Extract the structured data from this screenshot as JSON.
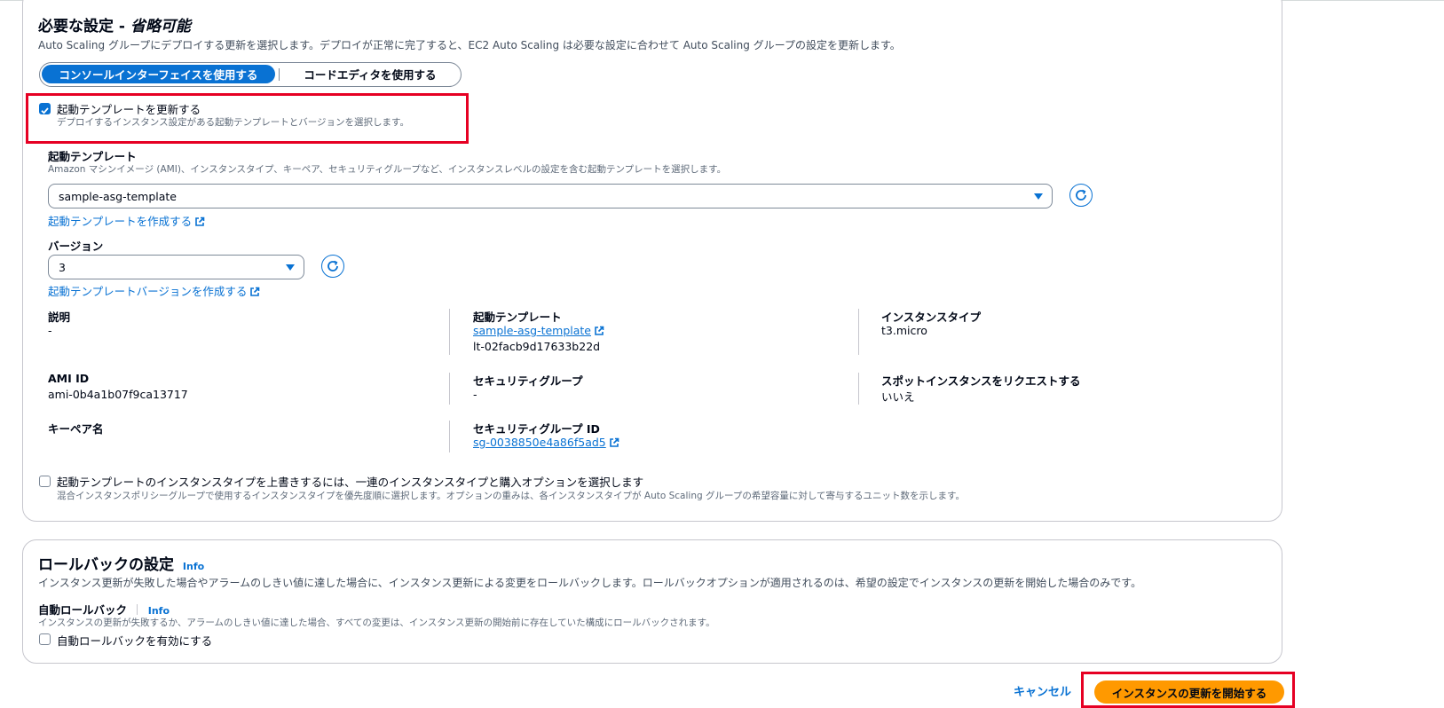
{
  "required_settings": {
    "title_main": "必要な設定 - ",
    "title_optional": "省略可能",
    "description": "Auto Scaling グループにデプロイする更新を選択します。デプロイが正常に完了すると、EC2 Auto Scaling は必要な設定に合わせて Auto Scaling グループの設定を更新します。",
    "segmented": {
      "console": "コンソールインターフェイスを使用する",
      "code_editor": "コードエディタを使用する"
    },
    "update_template": {
      "label": "起動テンプレートを更新する",
      "hint": "デプロイするインスタンス設定がある起動テンプレートとバージョンを選択します。",
      "checked": true
    },
    "launch_template": {
      "label": "起動テンプレート",
      "description": "Amazon マシンイメージ (AMI)、インスタンスタイプ、キーペア、セキュリティグループなど、インスタンスレベルの設定を含む起動テンプレートを選択します。",
      "selected": "sample-asg-template",
      "create_link": "起動テンプレートを作成する"
    },
    "version": {
      "label": "バージョン",
      "selected": "3",
      "create_link": "起動テンプレートバージョンを作成する"
    },
    "details": {
      "description_label": "説明",
      "description_value": "-",
      "template_label": "起動テンプレート",
      "template_link": "sample-asg-template",
      "template_id": "lt-02facb9d17633b22d",
      "instance_type_label": "インスタンスタイプ",
      "instance_type_value": "t3.micro",
      "ami_label": "AMI ID",
      "ami_value": "ami-0b4a1b07f9ca13717",
      "sg_label": "セキュリティグループ",
      "sg_value": "-",
      "spot_label": "スポットインスタンスをリクエストする",
      "spot_value": "いいえ",
      "keypair_label": "キーペア名",
      "sg_id_label": "セキュリティグループ ID",
      "sg_id_link": "sg-0038850e4a86f5ad5"
    },
    "override": {
      "label": "起動テンプレートのインスタンスタイプを上書きするには、一連のインスタンスタイプと購入オプションを選択します",
      "hint": "混合インスタンスポリシーグループで使用するインスタンスタイプを優先度順に選択します。オプションの重みは、各インスタンスタイプが Auto Scaling グループの希望容量に対して寄与するユニット数を示します。",
      "checked": false
    }
  },
  "rollback": {
    "title": "ロールバックの設定",
    "info": "Info",
    "description": "インスタンス更新が失敗した場合やアラームのしきい値に達した場合に、インスタンス更新による変更をロールバックします。ロールバックオプションが適用されるのは、希望の設定でインスタンスの更新を開始した場合のみです。",
    "auto_label": "自動ロールバック",
    "auto_info": "Info",
    "auto_hint": "インスタンスの更新が失敗するか、アラームのしきい値に達した場合、すべての変更は、インスタンス更新の開始前に存在していた構成にロールバックされます。",
    "enable_label": "自動ロールバックを有効にする",
    "enabled": false
  },
  "footer": {
    "cancel": "キャンセル",
    "start": "インスタンスの更新を開始する"
  },
  "colors": {
    "primary": "#0972d3",
    "accent_button": "#ff9900",
    "highlight": "#e60023"
  }
}
